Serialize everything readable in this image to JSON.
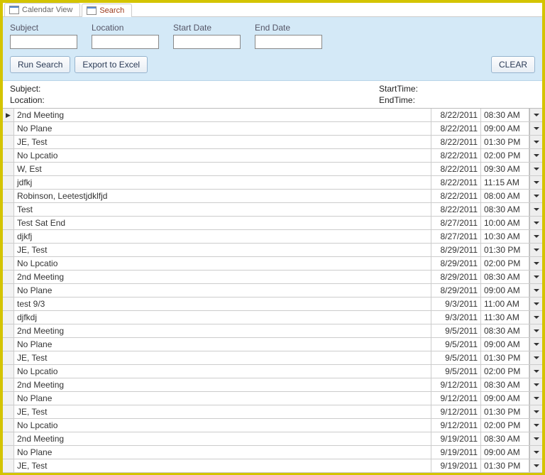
{
  "tabs": [
    {
      "label": "Calendar View",
      "active": false
    },
    {
      "label": "Search",
      "active": true
    }
  ],
  "search": {
    "fields": {
      "subject": {
        "label": "Subject",
        "value": ""
      },
      "location": {
        "label": "Location",
        "value": ""
      },
      "startDate": {
        "label": "Start Date",
        "value": ""
      },
      "endDate": {
        "label": "End Date",
        "value": ""
      }
    },
    "buttons": {
      "run": "Run Search",
      "export": "Export to Excel",
      "clear": "CLEAR"
    }
  },
  "detail": {
    "subjectLabel": "Subject:",
    "locationLabel": "Location:",
    "startTimeLabel": "StartTime:",
    "endTimeLabel": "EndTime:"
  },
  "rows": [
    {
      "subject": "2nd Meeting",
      "date": "8/22/2011",
      "time": "08:30 AM",
      "current": true
    },
    {
      "subject": "No Plane",
      "date": "8/22/2011",
      "time": "09:00 AM"
    },
    {
      "subject": "JE, Test",
      "date": "8/22/2011",
      "time": "01:30 PM"
    },
    {
      "subject": "No Lpcatio",
      "date": "8/22/2011",
      "time": "02:00 PM"
    },
    {
      "subject": "W, Est",
      "date": "8/22/2011",
      "time": "09:30 AM"
    },
    {
      "subject": "jdfkj",
      "date": "8/22/2011",
      "time": "11:15 AM"
    },
    {
      "subject": "Robinson, Leetestjdklfjd",
      "date": "8/22/2011",
      "time": "08:00 AM"
    },
    {
      "subject": "Test",
      "date": "8/22/2011",
      "time": "08:30 AM"
    },
    {
      "subject": "Test Sat End",
      "date": "8/27/2011",
      "time": "10:00 AM"
    },
    {
      "subject": "djkfj",
      "date": "8/27/2011",
      "time": "10:30 AM"
    },
    {
      "subject": "JE, Test",
      "date": "8/29/2011",
      "time": "01:30 PM"
    },
    {
      "subject": "No Lpcatio",
      "date": "8/29/2011",
      "time": "02:00 PM"
    },
    {
      "subject": "2nd Meeting",
      "date": "8/29/2011",
      "time": "08:30 AM"
    },
    {
      "subject": "No Plane",
      "date": "8/29/2011",
      "time": "09:00 AM"
    },
    {
      "subject": "test 9/3",
      "date": "9/3/2011",
      "time": "11:00 AM"
    },
    {
      "subject": "djfkdj",
      "date": "9/3/2011",
      "time": "11:30 AM"
    },
    {
      "subject": "2nd Meeting",
      "date": "9/5/2011",
      "time": "08:30 AM"
    },
    {
      "subject": "No Plane",
      "date": "9/5/2011",
      "time": "09:00 AM"
    },
    {
      "subject": "JE, Test",
      "date": "9/5/2011",
      "time": "01:30 PM"
    },
    {
      "subject": "No Lpcatio",
      "date": "9/5/2011",
      "time": "02:00 PM"
    },
    {
      "subject": "2nd Meeting",
      "date": "9/12/2011",
      "time": "08:30 AM"
    },
    {
      "subject": "No Plane",
      "date": "9/12/2011",
      "time": "09:00 AM"
    },
    {
      "subject": "JE, Test",
      "date": "9/12/2011",
      "time": "01:30 PM"
    },
    {
      "subject": "No Lpcatio",
      "date": "9/12/2011",
      "time": "02:00 PM"
    },
    {
      "subject": "2nd Meeting",
      "date": "9/19/2011",
      "time": "08:30 AM"
    },
    {
      "subject": "No Plane",
      "date": "9/19/2011",
      "time": "09:00 AM"
    },
    {
      "subject": "JE, Test",
      "date": "9/19/2011",
      "time": "01:30 PM"
    }
  ]
}
